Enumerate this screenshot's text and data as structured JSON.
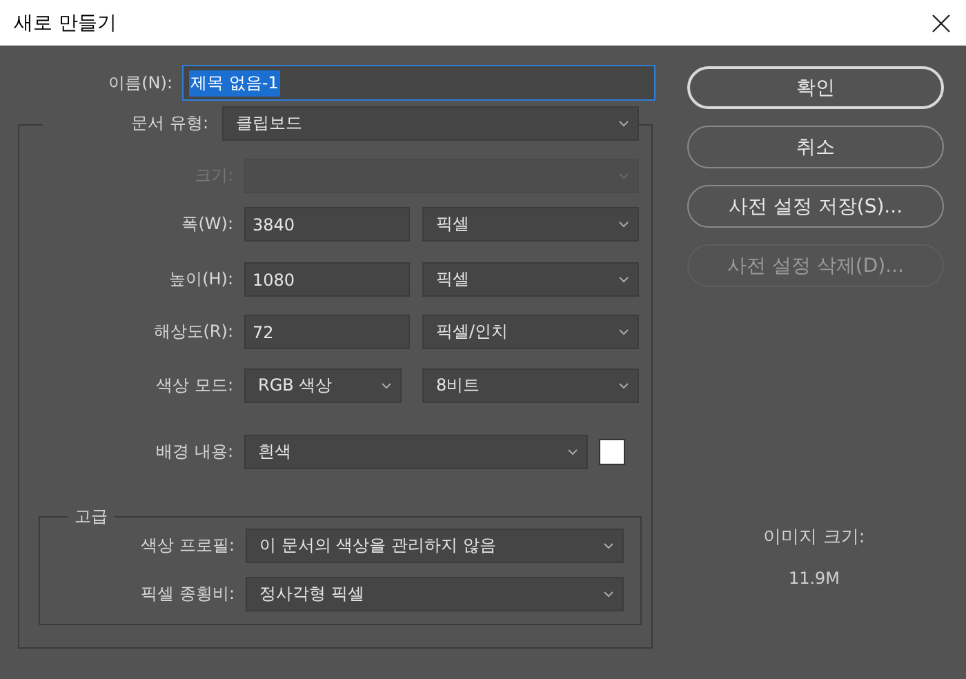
{
  "window": {
    "title": "새로 만들기"
  },
  "name": {
    "label": "이름(N):",
    "value": "제목 없음-1",
    "selected": true
  },
  "fields": [
    {
      "kind": "select",
      "label": "문서 유형:",
      "value": "클립보드",
      "disabled": false
    },
    {
      "kind": "select",
      "label": "크기:",
      "disabled": true
    },
    {
      "kind": "input_select",
      "label": "폭(W):",
      "value": "3840",
      "unit": "픽셀",
      "disabled": false
    },
    {
      "kind": "input_select",
      "label": "높이(H):",
      "value": "1080",
      "unit": "픽셀",
      "disabled": false
    },
    {
      "kind": "input_select",
      "label": "해상도(R):",
      "value": "72",
      "unit": "픽셀/인치",
      "disabled": false
    },
    {
      "kind": "select_select",
      "label": "색상 모드:",
      "value": "RGB 색상",
      "unit": "8비트",
      "disabled": false
    },
    {
      "kind": "select_swatch",
      "label": "배경 내용:",
      "value": "흰색",
      "color": "#ffffff",
      "disabled": false
    }
  ],
  "advanced": {
    "legend": "고급",
    "fields": [
      {
        "label": "색상 프로필:",
        "value": "이 문서의 색상을 관리하지 않음"
      },
      {
        "label": "픽셀 종횡비:",
        "value": "정사각형 픽셀"
      }
    ]
  },
  "buttons": [
    {
      "label": "확인",
      "default": true,
      "disabled": false
    },
    {
      "label": "취소",
      "default": false,
      "disabled": false
    },
    {
      "label": "사전 설정 저장(S)...",
      "default": false,
      "disabled": false
    },
    {
      "label": "사전 설정 삭제(D)...",
      "default": false,
      "disabled": true
    }
  ],
  "image_size": {
    "label": "이미지 크기:",
    "value": "11.9M"
  }
}
